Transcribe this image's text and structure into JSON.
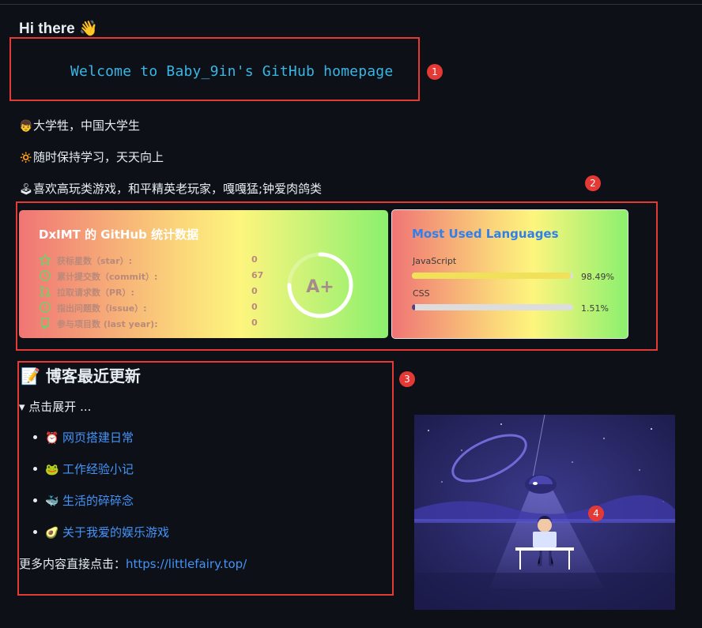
{
  "greeting": "Hi there 👋",
  "welcome": "Welcome to Baby_9in's GitHub homepage",
  "intro": [
    {
      "icon": "👦",
      "text": "大学牲，中国大学生"
    },
    {
      "icon": "🔅",
      "text": "随时保持学习，天天向上"
    },
    {
      "icon": "🕹",
      "text": "喜欢高玩类游戏，和平精英老玩家，嘎嘎猛;钟爱肉鸽类"
    }
  ],
  "annotations": [
    "1",
    "2",
    "3",
    "4"
  ],
  "stats": {
    "title": "DxIMT 的 GitHub 统计数据",
    "rows": [
      {
        "label": "获标星数（star）:",
        "value": "0",
        "icon": "star-icon"
      },
      {
        "label": "累计提交数（commit）:",
        "value": "67",
        "icon": "history-icon"
      },
      {
        "label": "拉取请求数（PR）:",
        "value": "0",
        "icon": "pull-request-icon"
      },
      {
        "label": "指出问题数（issue）:",
        "value": "0",
        "icon": "issue-icon"
      },
      {
        "label": "参与项目数 (last year):",
        "value": "0",
        "icon": "repo-icon"
      }
    ],
    "grade": "A+",
    "grade_progress": 0.75
  },
  "languages": {
    "title": "Most Used Languages",
    "items": [
      {
        "name": "JavaScript",
        "percent_label": "98.49%",
        "percent": 98.49,
        "color": "#f1e05a"
      },
      {
        "name": "CSS",
        "percent_label": "1.51%",
        "percent": 1.51,
        "color": "#563d7c"
      }
    ]
  },
  "blog": {
    "title": "📝 博客最近更新",
    "summary": "▾ 点击展开 ...",
    "items": [
      {
        "icon": "⏰",
        "text": "网页搭建日常"
      },
      {
        "icon": "🐸",
        "text": "工作经验小记"
      },
      {
        "icon": "🐳",
        "text": "生活的碎碎念"
      },
      {
        "icon": "🥑",
        "text": "关于我爱的娱乐游戏"
      }
    ],
    "more_label": "更多内容直接点击：",
    "more_link": "https://littlefairy.top/"
  },
  "colors": {
    "annotation": "#e53935",
    "link": "#4493f8",
    "welcome": "#39b6e6",
    "background": "#0d1117"
  }
}
